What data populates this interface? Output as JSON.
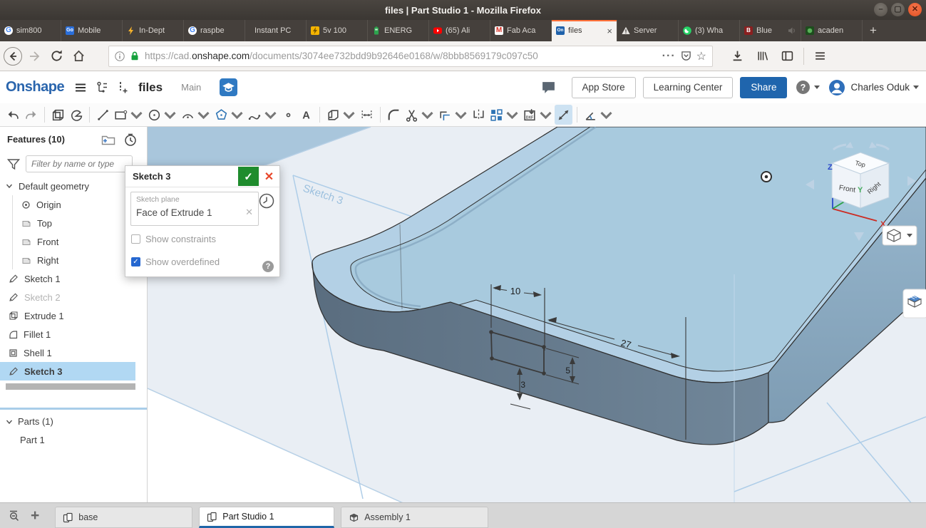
{
  "window": {
    "title": "files | Part Studio 1 - Mozilla Firefox"
  },
  "browser": {
    "tabs": [
      {
        "icon": "google",
        "label": "sim800"
      },
      {
        "icon": "blue-app",
        "label": "Mobile"
      },
      {
        "icon": "lightning",
        "label": "In-Dept"
      },
      {
        "icon": "google",
        "label": "raspbe"
      },
      {
        "icon": "none",
        "label": "Instant PC"
      },
      {
        "icon": "yellow-app",
        "label": "5v 100"
      },
      {
        "icon": "battery",
        "label": "ENERG"
      },
      {
        "icon": "youtube",
        "label": "(65) Ali"
      },
      {
        "icon": "gmail",
        "label": "Fab Aca"
      },
      {
        "icon": "onshape",
        "label": "files",
        "active": true,
        "close_label": "×"
      },
      {
        "icon": "warning",
        "label": "Server"
      },
      {
        "icon": "whatsapp",
        "label": "(3) Wha"
      },
      {
        "icon": "red-app",
        "label": "Blue",
        "audio": true
      },
      {
        "icon": "green-app",
        "label": "acaden"
      }
    ],
    "new_tab_label": "+",
    "url": {
      "scheme": "https://",
      "subdomain": "cad.",
      "domain": "onshape.com",
      "path": "/documents/3074ee732bdd9b92646e0168/w/8bbb8569179c097c50"
    }
  },
  "onshape_header": {
    "logo": "Onshape",
    "document_title": "files",
    "workspace": "Main",
    "app_store": "App Store",
    "learning_center": "Learning Center",
    "share": "Share",
    "user_name": "Charles Oduk"
  },
  "toolbar": {
    "items": [
      {
        "id": "undo"
      },
      {
        "id": "redo"
      },
      {
        "sep": true
      },
      {
        "id": "extrude"
      },
      {
        "id": "revolve"
      },
      {
        "sep": true
      },
      {
        "id": "line"
      },
      {
        "id": "rectangle",
        "dd": true
      },
      {
        "id": "circle",
        "dd": true
      },
      {
        "id": "arc",
        "dd": true
      },
      {
        "id": "polygon",
        "dd": true
      },
      {
        "id": "spline",
        "dd": true
      },
      {
        "id": "point"
      },
      {
        "id": "text"
      },
      {
        "sep": true
      },
      {
        "id": "use-project",
        "dd": true
      },
      {
        "id": "distance"
      },
      {
        "sep": true
      },
      {
        "id": "fillet"
      },
      {
        "id": "trim",
        "dd": true
      },
      {
        "id": "offset",
        "dd": true
      },
      {
        "id": "mirror"
      },
      {
        "id": "pattern",
        "dd": true
      },
      {
        "id": "import-dxf",
        "dd": true
      },
      {
        "id": "dimension",
        "active": true
      },
      {
        "sep": true
      },
      {
        "id": "constraint",
        "dd": true
      }
    ]
  },
  "features_panel": {
    "title": "Features (10)",
    "filter_placeholder": "Filter by name or type",
    "tree": [
      {
        "label": "Default geometry",
        "icon": "chevron-down",
        "kind": "group"
      },
      {
        "label": "Origin",
        "icon": "origin",
        "indent": 1
      },
      {
        "label": "Top",
        "icon": "plane",
        "indent": 1
      },
      {
        "label": "Front",
        "icon": "plane",
        "indent": 1
      },
      {
        "label": "Right",
        "icon": "plane",
        "indent": 1
      },
      {
        "label": "Sketch 1",
        "icon": "sketch"
      },
      {
        "label": "Sketch 2",
        "icon": "sketch",
        "muted": true
      },
      {
        "label": "Extrude 1",
        "icon": "extrude"
      },
      {
        "label": "Fillet 1",
        "icon": "fillet"
      },
      {
        "label": "Shell 1",
        "icon": "shell"
      },
      {
        "label": "Sketch 3",
        "icon": "sketch",
        "selected": true
      }
    ],
    "parts_title": "Parts (1)",
    "parts": [
      {
        "label": "Part 1"
      }
    ]
  },
  "dialog": {
    "title": "Sketch 3",
    "plane_label": "Sketch plane",
    "plane_value": "Face of Extrude 1",
    "constraints_label": "Show constraints",
    "constraints_checked": false,
    "overdefined_label": "Show overdefined",
    "overdefined_checked": true
  },
  "viewport": {
    "sketch_plane_label": "Sketch 3",
    "dim_width": "10",
    "dim_length": "27",
    "dim_height": "5",
    "dim_offset": "3",
    "view_cube": {
      "top": "Top",
      "front": "Front",
      "right": "Right",
      "axis_x": "X",
      "axis_y": "Y",
      "axis_z": "Z"
    }
  },
  "bottom_bar": {
    "tabs": [
      {
        "label": "base",
        "type": "partstudio"
      },
      {
        "label": "Part Studio 1",
        "type": "partstudio",
        "active": true
      },
      {
        "label": "Assembly 1",
        "type": "assembly"
      }
    ]
  }
}
